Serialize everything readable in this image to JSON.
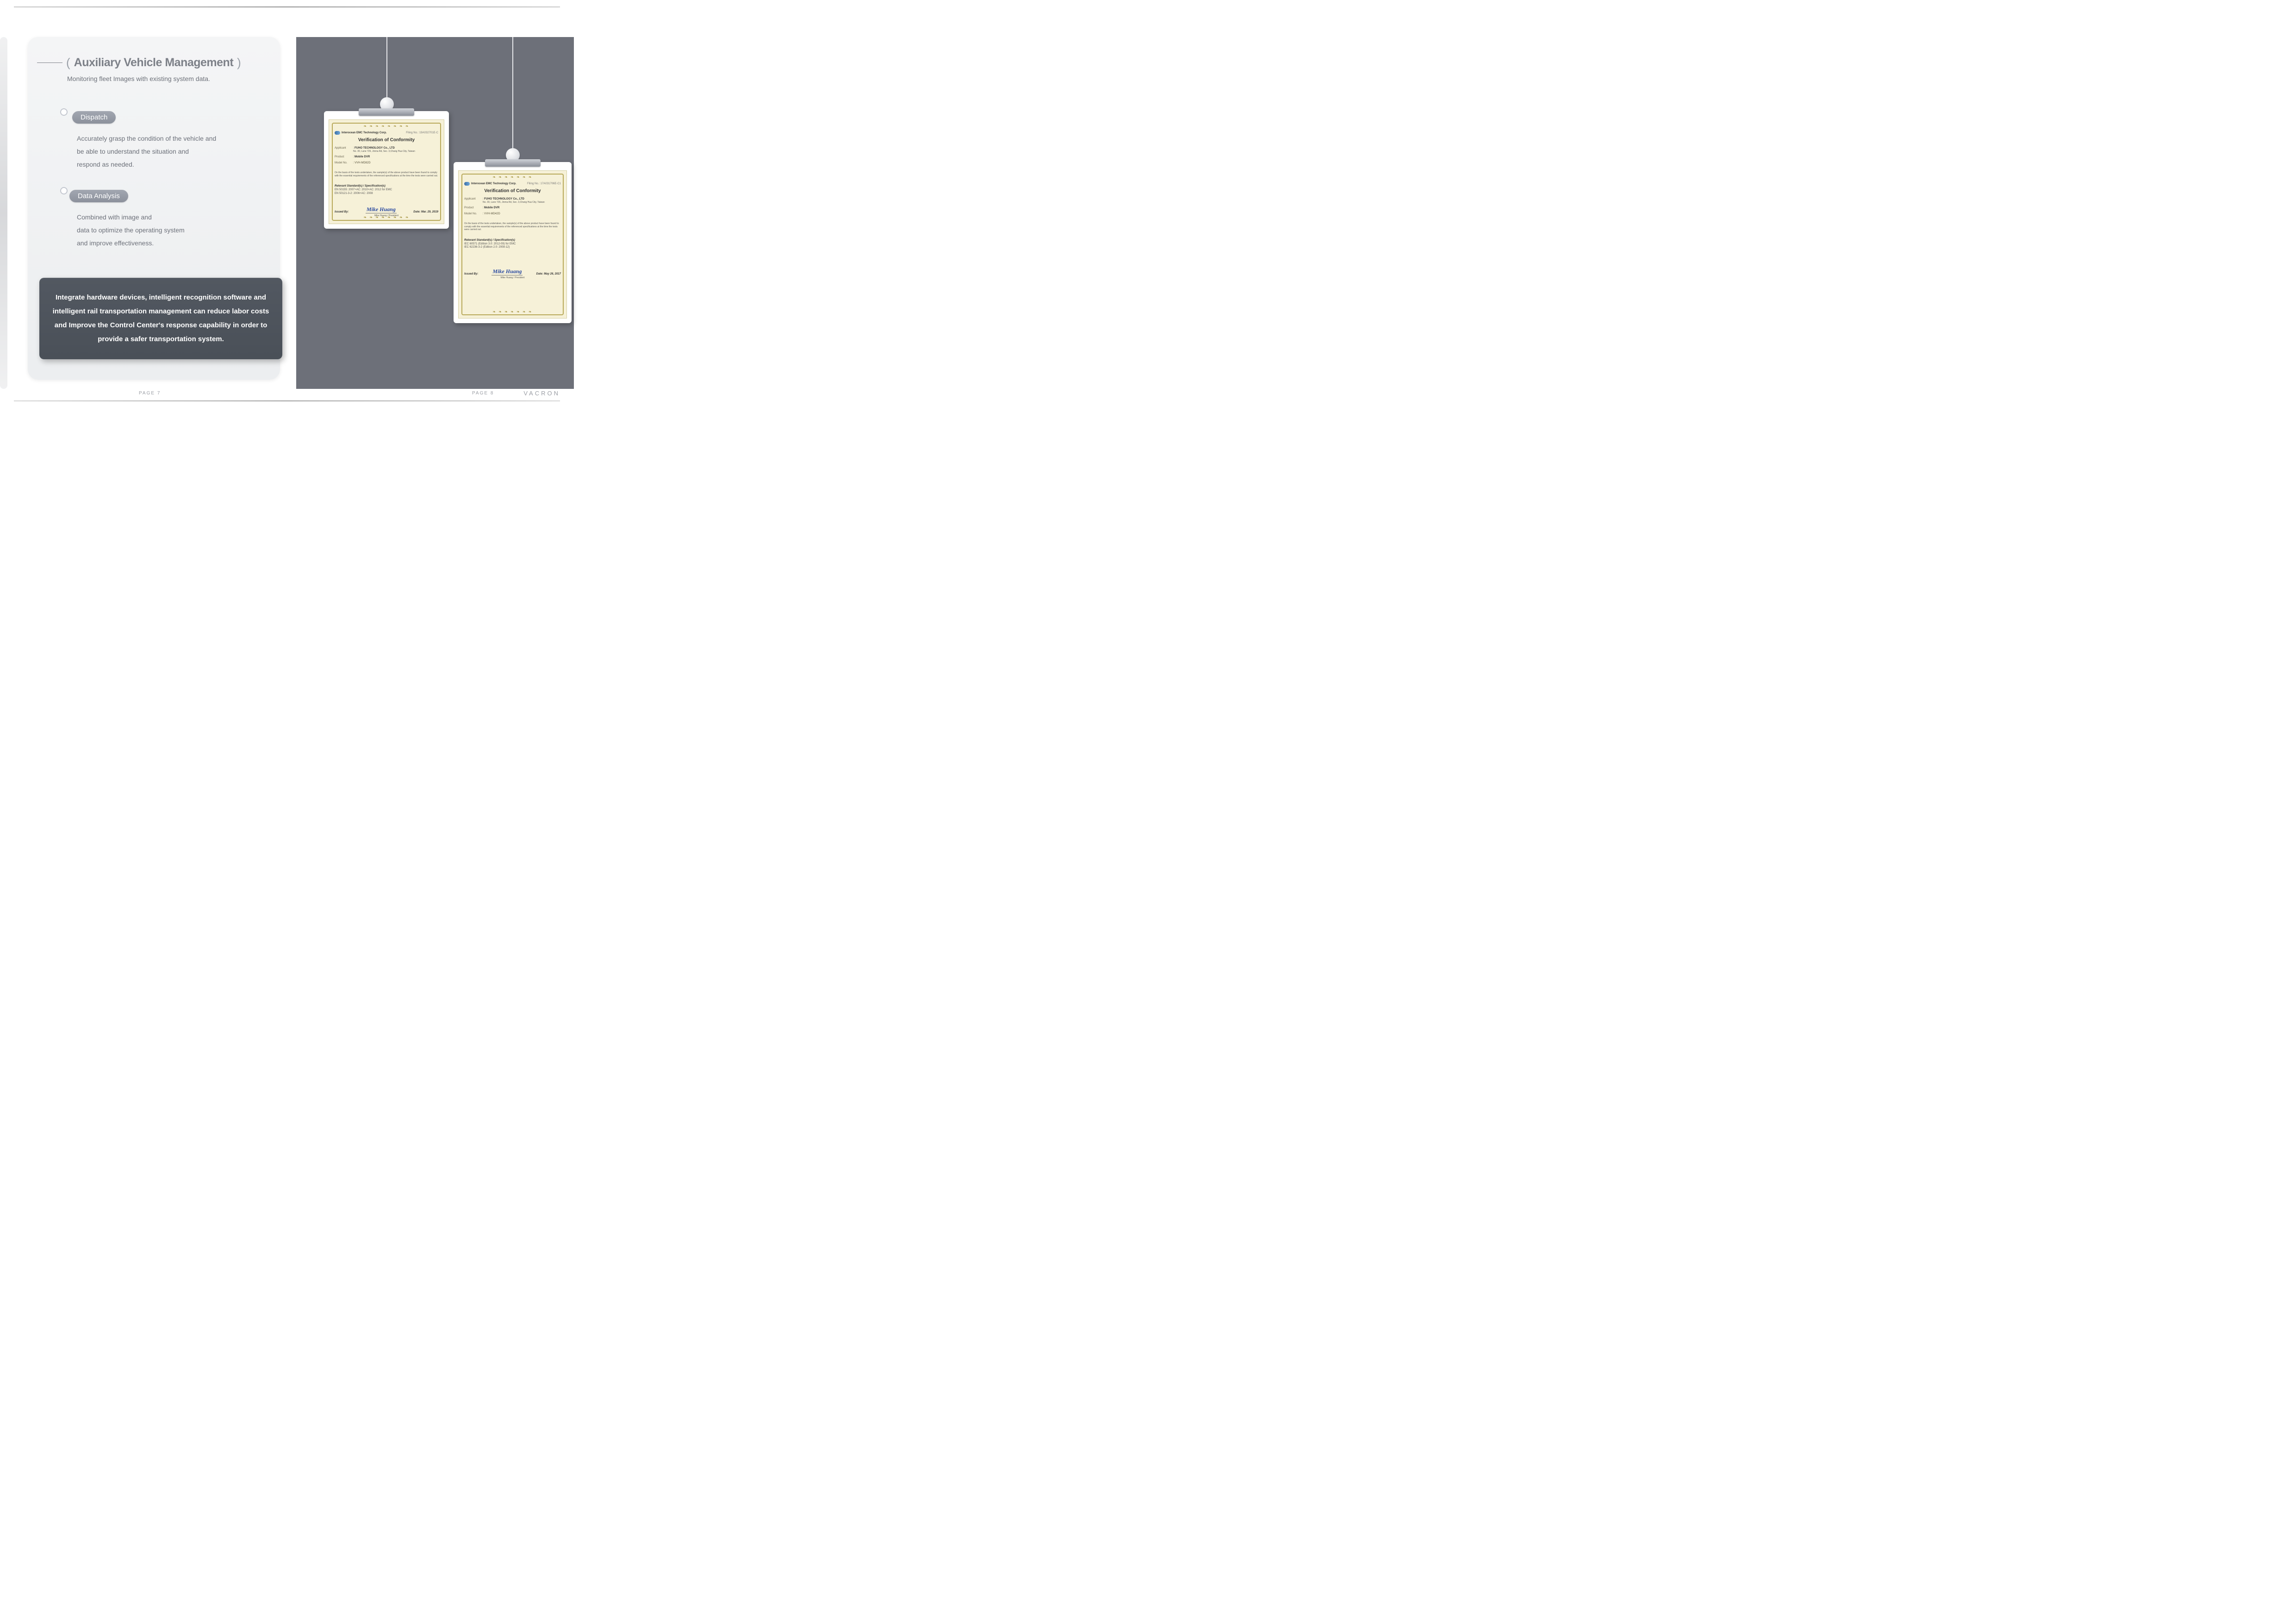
{
  "heading": "Auxiliary Vehicle Management",
  "subheading": "Monitoring fleet Images with existing system data.",
  "sections": {
    "dispatch": {
      "label": "Dispatch",
      "body": "Accurately grasp the condition of the vehicle and\nbe able to understand the situation and\nrespond as needed."
    },
    "analysis": {
      "label": "Data Analysis",
      "body": "Combined with image and\ndata to optimize the operating system\nand improve effectiveness."
    }
  },
  "callout": "Integrate hardware devices, intelligent recognition software and intelligent rail transportation management can reduce labor costs and Improve the Control Center's response capability in order to provide a safer transportation system.",
  "certificates": [
    {
      "issuer": "Interocean EMC Technology Corp.",
      "filing": "Filing No.: 19A032701E-C",
      "title": "Verification of Conformity",
      "applicant": "FUHO TECHNOLOGY Co., LTD",
      "address": "No. 30, Lane 726, Jinma Rd, Sec. 3,Chang Hua City, Taiwan",
      "product": "Mobile DVR",
      "model": "VVH-MD82D",
      "basis": "On the basis of the tests undertaken, the sample(s) of the above product have been found to comply with the essential requirements of the referenced specifications at the time the tests were carried out.",
      "std_title": "Relevant Standard(s) / Specification(s)",
      "standards": "EN 50155: 2007+AC: 2010+AC: 2012 for EMC\n    EN 50121-3-2: 2006+AC: 2008",
      "issued_by": "Issued By:",
      "signature": "Mike Huang",
      "sign_sub": "Mike Huang / President",
      "date_label": "Date: Mar. 29, 2019"
    },
    {
      "issuer": "Interocean EMC Technology Corp.",
      "filing": "Filing No.: 17A031706E-C1",
      "title": "Verification of Conformity",
      "applicant": "FUHO TECHNOLOGY Co., LTD",
      "address": "No. 30, Lane 726, Jinma Rd, Sec. 3,Chang Hua City, Taiwan",
      "product": "Mobile DVR",
      "model": "VVH-MD42D",
      "basis": "On the basis of the tests undertaken, the sample(s) of the above product have been found to comply with the essential requirements of the referenced specifications at the time the tests were carried out.",
      "std_title": "Relevant Standard(s) / Specification(s)",
      "standards": "IEC 60571 (Edition 3.0: 2012-09) for EMC\n    IEC 62236-3-2 (Edition 2.0: 2008-12)",
      "issued_by": "Issued By:",
      "signature": "Mike Huang",
      "sign_sub": "Mike Huang / President",
      "date_label": "Date: May 26, 2017"
    }
  ],
  "page_left": "PAGE 7",
  "page_right": "PAGE 8",
  "brand": "VACRON",
  "labels": {
    "applicant": "Applicant",
    "product": "Product",
    "model": "Model No."
  }
}
